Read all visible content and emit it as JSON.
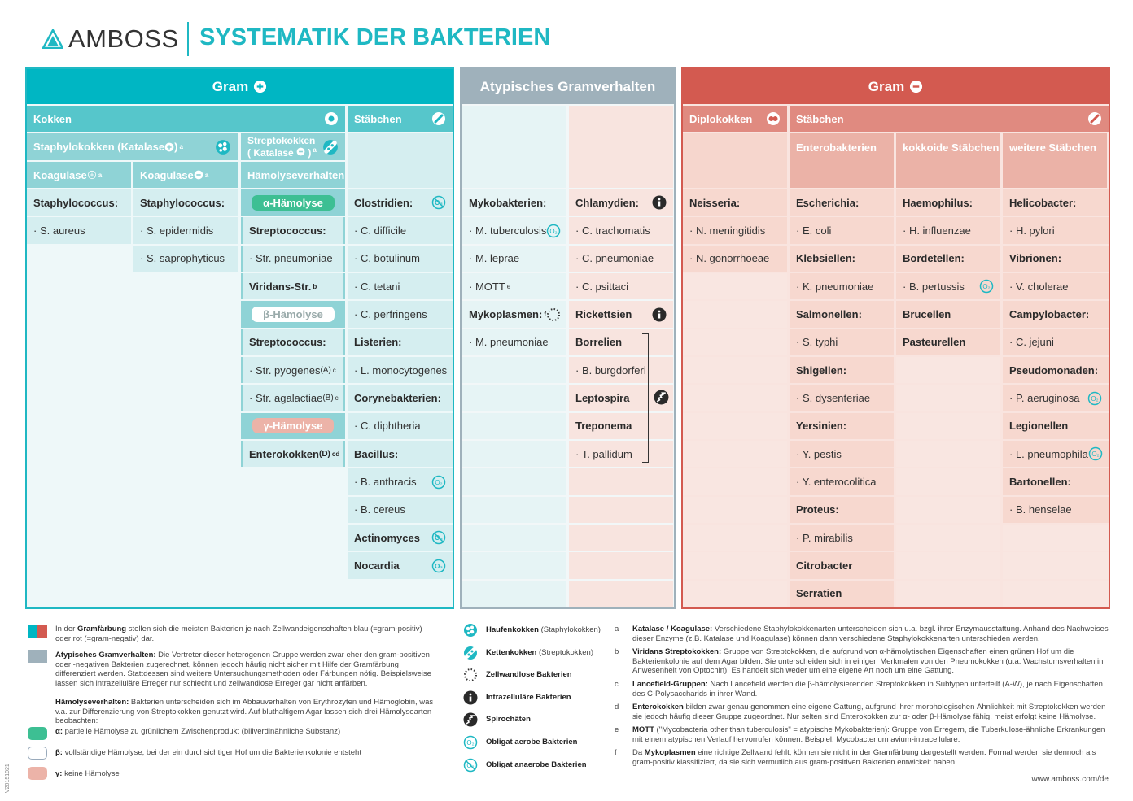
{
  "header": {
    "logo": "AMBOSS",
    "title": "SYSTEMATIK DER BAKTERIEN"
  },
  "colors": {
    "teal": "#00b6c3",
    "red": "#d35a50",
    "gray": "#9fb1bb",
    "alpha": "#3dbf93",
    "gamma": "#ecb3a8"
  },
  "gram_pos": {
    "title": "Gram",
    "title_icon": "plus-circle",
    "kokken": "Kokken",
    "kokken_icon": "coccus",
    "staebchen": "Stäbchen",
    "staebchen_icon": "rod",
    "staph": {
      "text": "Staphylokokken (Katalase",
      "icon": "plus-circle",
      "end": ")",
      "sup": "a",
      "group_icon": "staph-cluster"
    },
    "strep": {
      "text": "Streptokokken",
      "line2": "( Katalase",
      "icon": "minus-circle",
      "end": ")",
      "sup": "a",
      "group_icon": "strep-chain"
    },
    "koag_pos": {
      "text": "Koagulase",
      "icon": "plus-outline",
      "sup": "a"
    },
    "koag_neg": {
      "text": "Koagulase",
      "icon": "minus-circle",
      "sup": "a"
    },
    "haemolyse": "Hämolyseverhalten",
    "columns": [
      [
        {
          "t": "h",
          "x": "Staphylococcus:"
        },
        {
          "t": "i",
          "x": "· S. aureus"
        }
      ],
      [
        {
          "t": "h",
          "x": "Staphylococcus:"
        },
        {
          "t": "i",
          "x": "· S. epidermidis"
        },
        {
          "t": "i",
          "x": "· S. saprophyticus"
        }
      ],
      [
        {
          "t": "pill",
          "x": "α-Hämolyse",
          "c": "alpha"
        },
        {
          "t": "h",
          "x": "Streptococcus:"
        },
        {
          "t": "i",
          "x": "· Str. pneumoniae"
        },
        {
          "t": "h",
          "x": "Viridans-Str.",
          "sup": "b"
        },
        {
          "t": "pill",
          "x": "β-Hämolyse",
          "c": "beta"
        },
        {
          "t": "h",
          "x": "Streptococcus:"
        },
        {
          "t": "i",
          "x": "· Str. pyogenes",
          "small": "(A)",
          "sup": "c"
        },
        {
          "t": "i",
          "x": "· Str. agalactiae",
          "small": "(B)",
          "sup": "c"
        },
        {
          "t": "pill",
          "x": "γ-Hämolyse",
          "c": "gamma"
        },
        {
          "t": "h",
          "x": "Enterokokken",
          "small": "(D)",
          "sup": "cd"
        }
      ],
      [
        {
          "t": "h",
          "x": "Clostridien:",
          "icon": "anaerobe"
        },
        {
          "t": "i",
          "x": "· C. difficile"
        },
        {
          "t": "i",
          "x": "· C. botulinum"
        },
        {
          "t": "i",
          "x": "· C. tetani"
        },
        {
          "t": "i",
          "x": "· C. perfringens"
        },
        {
          "t": "h",
          "x": "Listerien:"
        },
        {
          "t": "i",
          "x": "· L. monocytogenes"
        },
        {
          "t": "h",
          "x": "Corynebakterien:"
        },
        {
          "t": "i",
          "x": "· C. diphtheria"
        },
        {
          "t": "h",
          "x": "Bacillus:"
        },
        {
          "t": "i",
          "x": "· B. anthracis",
          "icon": "aerobe"
        },
        {
          "t": "i",
          "x": "· B. cereus"
        },
        {
          "t": "h",
          "x": "Actinomyces",
          "icon": "anaerobe"
        },
        {
          "t": "h",
          "x": "Nocardia",
          "icon": "aerobe"
        }
      ]
    ]
  },
  "atypical": {
    "title": "Atypisches Gramverhalten",
    "columns": [
      [
        {
          "t": "h",
          "x": "Mykobakterien:"
        },
        {
          "t": "i",
          "x": "· M. tuberculosis",
          "icon": "aerobe"
        },
        {
          "t": "i",
          "x": "· M. leprae"
        },
        {
          "t": "i",
          "x": "· MOTT",
          "sup": "e"
        },
        {
          "t": "h",
          "x": "Mykoplasmen:",
          "sup": "f",
          "icon": "cell-wall-less"
        },
        {
          "t": "i",
          "x": "· M. pneumoniae"
        }
      ],
      [
        {
          "t": "h",
          "x": "Chlamydien:",
          "icon": "intracellular"
        },
        {
          "t": "i",
          "x": "· C. trachomatis"
        },
        {
          "t": "i",
          "x": "· C. pneumoniae"
        },
        {
          "t": "i",
          "x": "· C. psittaci"
        },
        {
          "t": "h",
          "x": "Rickettsien",
          "icon": "intracellular"
        },
        {
          "t": "h",
          "x": "Borrelien"
        },
        {
          "t": "i",
          "x": "· B. burgdorferi"
        },
        {
          "t": "h",
          "x": "Leptospira"
        },
        {
          "t": "h",
          "x": "Treponema"
        },
        {
          "t": "i",
          "x": "· T. pallidum"
        }
      ]
    ],
    "spiro_icon": "spirochete"
  },
  "gram_neg": {
    "title": "Gram",
    "title_icon": "minus-circle",
    "diplo": "Diplokokken",
    "diplo_icon": "diplococcus",
    "staebchen": "Stäbchen",
    "staebchen_icon": "rod",
    "sub": [
      "Enterobakterien",
      "kokkoide Stäbchen",
      "weitere Stäbchen"
    ],
    "columns": [
      [
        {
          "t": "h",
          "x": "Neisseria:"
        },
        {
          "t": "i",
          "x": "· N. meningitidis"
        },
        {
          "t": "i",
          "x": "· N. gonorrhoeae"
        }
      ],
      [
        {
          "t": "h",
          "x": "Escherichia:"
        },
        {
          "t": "i",
          "x": "· E. coli"
        },
        {
          "t": "h",
          "x": "Klebsiellen:"
        },
        {
          "t": "i",
          "x": "· K. pneumoniae"
        },
        {
          "t": "h",
          "x": "Salmonellen:"
        },
        {
          "t": "i",
          "x": "· S. typhi"
        },
        {
          "t": "h",
          "x": "Shigellen:"
        },
        {
          "t": "i",
          "x": "· S. dysenteriae"
        },
        {
          "t": "h",
          "x": "Yersinien:"
        },
        {
          "t": "i",
          "x": "· Y. pestis"
        },
        {
          "t": "i",
          "x": "· Y. enterocolitica"
        },
        {
          "t": "h",
          "x": "Proteus:"
        },
        {
          "t": "i",
          "x": "· P. mirabilis"
        },
        {
          "t": "h",
          "x": "Citrobacter"
        },
        {
          "t": "h",
          "x": "Serratien"
        }
      ],
      [
        {
          "t": "h",
          "x": "Haemophilus:"
        },
        {
          "t": "i",
          "x": "· H. influenzae"
        },
        {
          "t": "h",
          "x": "Bordetellen:"
        },
        {
          "t": "i",
          "x": "· B. pertussis",
          "icon": "aerobe"
        },
        {
          "t": "h",
          "x": "Brucellen"
        },
        {
          "t": "h",
          "x": "Pasteurellen"
        }
      ],
      [
        {
          "t": "h",
          "x": "Helicobacter:"
        },
        {
          "t": "i",
          "x": "· H. pylori"
        },
        {
          "t": "h",
          "x": "Vibrionen:"
        },
        {
          "t": "i",
          "x": "· V. cholerae"
        },
        {
          "t": "h",
          "x": "Campylobacter:"
        },
        {
          "t": "i",
          "x": "· C. jejuni"
        },
        {
          "t": "h",
          "x": "Pseudomonaden:"
        },
        {
          "t": "i",
          "x": "· P. aeruginosa",
          "icon": "aerobe"
        },
        {
          "t": "h",
          "x": "Legionellen"
        },
        {
          "t": "i",
          "x": "· L. pneumophila",
          "icon": "aerobe"
        },
        {
          "t": "h",
          "x": "Bartonellen:"
        },
        {
          "t": "i",
          "x": "· B. henselae"
        }
      ]
    ]
  },
  "legend_left": [
    {
      "b": "",
      "pre": "In der ",
      "bold": "Gramfärbung",
      "rest": " stellen sich die meisten Bakterien je nach Zellwandeigenschaften blau (=gram-positiv) oder rot (=gram-negativ) dar."
    },
    {
      "pre": "",
      "bold": "Atypisches Gramverhalten:",
      "rest": " Die Vertreter dieser heterogenen Gruppe werden zwar eher den gram-positiven oder -negativen Bakterien zugerechnet, können jedoch häufig nicht sicher mit Hilfe der Gramfärbung differenziert werden. Stattdessen sind weitere Untersuchungsmethoden oder Färbungen nötig. Beispielsweise lassen sich intrazelluläre Erreger nur schlecht und zellwandlose Erreger gar nicht anfärben."
    },
    {
      "pre": "",
      "bold": "Hämolyseverhalten:",
      "rest": " Bakterien unterscheiden sich im Abbauverhalten von Erythrozyten und Hämoglobin, was v.a. zur Differenzierung von Streptokokken genutzt wird. Auf bluthaltigem Agar lassen sich drei Hämolysearten beobachten:"
    },
    {
      "pre": "",
      "bold": "α:",
      "rest": " partielle Hämolyse zu grünlichem Zwischenprodukt (biliverdinähnliche Substanz)"
    },
    {
      "pre": "",
      "bold": "β:",
      "rest": " vollständige Hämolyse, bei der ein durchsichtiger Hof um die Bakterienkolonie entsteht"
    },
    {
      "pre": "",
      "bold": "γ:",
      "rest": " keine Hämolyse"
    }
  ],
  "legend_icons": [
    {
      "icon": "staph-cluster",
      "bold": "Haufenkokken",
      "rest": " (Staphylokokken)"
    },
    {
      "icon": "strep-chain",
      "bold": "Kettenkokken",
      "rest": " (Streptokokken)"
    },
    {
      "icon": "cell-wall-less",
      "bold": "Zellwandlose Bakterien",
      "rest": ""
    },
    {
      "icon": "intracellular",
      "bold": "Intrazelluläre Bakterien",
      "rest": ""
    },
    {
      "icon": "spirochete",
      "bold": "Spirochäten",
      "rest": ""
    },
    {
      "icon": "aerobe",
      "bold": "Obligat aerobe Bakterien",
      "rest": ""
    },
    {
      "icon": "anaerobe",
      "bold": "Obligat anaerobe Bakterien",
      "rest": ""
    }
  ],
  "footnotes": [
    {
      "k": "a",
      "pre": "",
      "bold": "Katalase / Koagulase:",
      "rest": " Verschiedene Staphylokokkenarten unterscheiden sich u.a. bzgl. ihrer Enzymausstattung. Anhand des Nachweises dieser Enzyme (z.B. Katalase und Koagulase) können dann verschiedene Staphylokokkenarten unterschieden werden."
    },
    {
      "k": "b",
      "pre": "",
      "bold": "Viridans Streptokokken:",
      "rest": " Gruppe von Streptokokken, die aufgrund von α-hämolytischen Eigenschaften einen grünen Hof um die Bakterienkolonie auf dem Agar bilden. Sie unterscheiden sich in einigen Merkmalen von den Pneumokokken (u.a. Wachstumsverhalten in Anwesenheit von Optochin). Es handelt sich weder um eine eigene Art noch um eine Gattung."
    },
    {
      "k": "c",
      "pre": "",
      "bold": "Lancefield-Gruppen:",
      "rest": " Nach Lancefield werden die β-hämolysierenden Streptokokken in Subtypen unterteilt (A-W), je nach Eigenschaften des C-Polysaccharids in ihrer Wand."
    },
    {
      "k": "d",
      "pre": "",
      "bold": "Enterokokken",
      "rest": " bilden zwar genau genommen eine eigene Gattung, aufgrund ihrer morphologischen Ähnlichkeit mit Streptokokken werden sie jedoch häufig dieser Gruppe zugeordnet. Nur selten sind Enterokokken zur α- oder β-Hämolyse fähig, meist erfolgt keine Hämolyse."
    },
    {
      "k": "e",
      "pre": "",
      "bold": "MOTT",
      "rest": " (\"Mycobacteria other than tuberculosis\" = atypische Mykobakterien): Gruppe von Erregern, die Tuberkulose-ähnliche Erkrankungen mit einem atypischen Verlauf hervorrufen können. Beispiel: Mycobacterium avium-intracellulare."
    },
    {
      "k": "f",
      "pre": "Da ",
      "bold": "Mykoplasmen",
      "rest": " eine richtige Zellwand fehlt, können sie nicht in der Gramfärbung dargestellt werden. Formal werden sie dennoch als gram-positiv klassifiziert, da sie sich vermutlich aus gram-positiven Bakterien entwickelt haben."
    }
  ],
  "url": "www.amboss.com/de",
  "version": "V20151021"
}
